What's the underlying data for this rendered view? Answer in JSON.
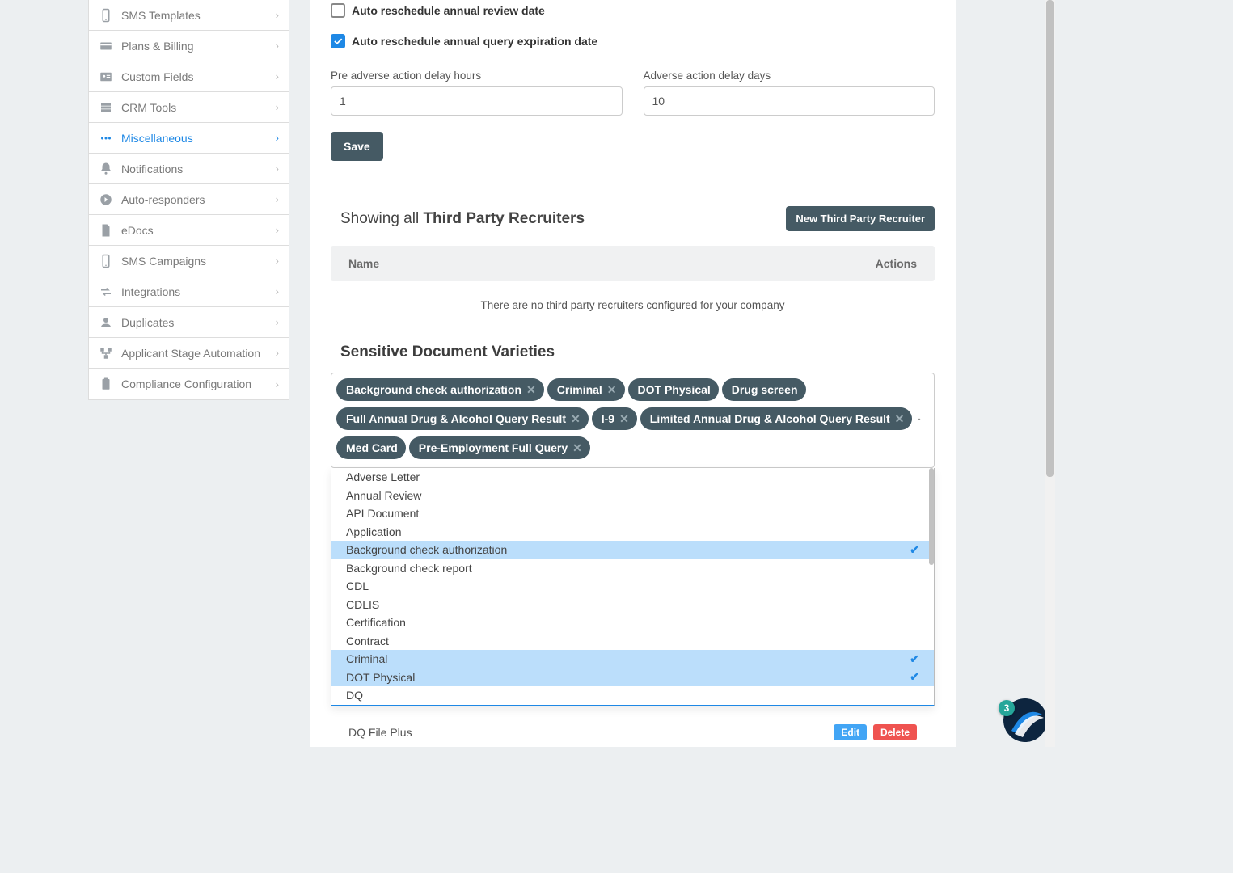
{
  "sidebar": {
    "items": [
      {
        "label": "SMS Templates",
        "icon": "mobile"
      },
      {
        "label": "Plans & Billing",
        "icon": "card"
      },
      {
        "label": "Custom Fields",
        "icon": "idcard"
      },
      {
        "label": "CRM Tools",
        "icon": "server"
      },
      {
        "label": "Miscellaneous",
        "icon": "dots",
        "active": true
      },
      {
        "label": "Notifications",
        "icon": "bell"
      },
      {
        "label": "Auto-responders",
        "icon": "arrow-circle"
      },
      {
        "label": "eDocs",
        "icon": "file"
      },
      {
        "label": "SMS Campaigns",
        "icon": "mobile"
      },
      {
        "label": "Integrations",
        "icon": "swap"
      },
      {
        "label": "Duplicates",
        "icon": "user"
      },
      {
        "label": "Applicant Stage Automation",
        "icon": "flow"
      },
      {
        "label": "Compliance Configuration",
        "icon": "clipboard"
      }
    ]
  },
  "checkboxes": {
    "auto_review": {
      "label": "Auto reschedule annual review date",
      "checked": false
    },
    "auto_query": {
      "label": "Auto reschedule annual query expiration date",
      "checked": true
    }
  },
  "fields": {
    "pre_hours": {
      "label": "Pre adverse action delay hours",
      "value": "1"
    },
    "adv_days": {
      "label": "Adverse action delay days",
      "value": "10"
    }
  },
  "save_label": "Save",
  "recruiters": {
    "showing_prefix": "Showing all ",
    "showing_bold": "Third Party Recruiters",
    "new_button": "New Third Party Recruiter",
    "col_name": "Name",
    "col_actions": "Actions",
    "empty": "There are no third party recruiters configured for your company"
  },
  "sdv": {
    "title": "Sensitive Document Varieties",
    "tags": [
      {
        "label": "Background check authorization",
        "x": true
      },
      {
        "label": "Criminal",
        "x": true
      },
      {
        "label": "DOT Physical",
        "x": false
      },
      {
        "label": "Drug screen",
        "x": false
      },
      {
        "label": "Full Annual Drug & Alcohol Query Result",
        "x": true
      },
      {
        "label": "I-9",
        "x": true
      },
      {
        "label": "Limited Annual Drug & Alcohol Query Result",
        "x": true
      },
      {
        "label": "Med Card",
        "x": false
      },
      {
        "label": "Pre-Employment Full Query",
        "x": true
      }
    ],
    "options": [
      {
        "label": "Adverse Letter",
        "selected": false
      },
      {
        "label": "Annual Review",
        "selected": false
      },
      {
        "label": "API Document",
        "selected": false
      },
      {
        "label": "Application",
        "selected": false
      },
      {
        "label": "Background check authorization",
        "selected": true
      },
      {
        "label": "Background check report",
        "selected": false
      },
      {
        "label": "CDL",
        "selected": false
      },
      {
        "label": "CDLIS",
        "selected": false
      },
      {
        "label": "Certification",
        "selected": false
      },
      {
        "label": "Contract",
        "selected": false
      },
      {
        "label": "Criminal",
        "selected": true
      },
      {
        "label": "DOT Physical",
        "selected": true
      },
      {
        "label": "DQ",
        "selected": false
      }
    ]
  },
  "dq_row": {
    "label": "DQ File Plus",
    "edit": "Edit",
    "delete": "Delete"
  },
  "badge_count": "3"
}
